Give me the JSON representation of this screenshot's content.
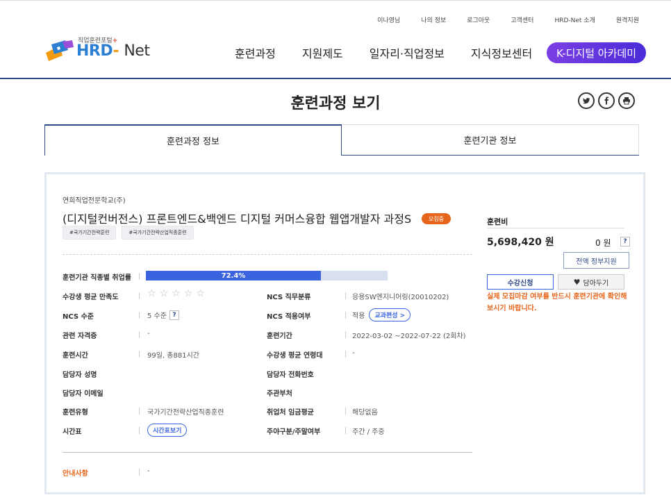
{
  "util_nav": [
    "이나영님",
    "나의 정보",
    "로그아웃",
    "고객센터",
    "HRD-Net 소개",
    "원격지원"
  ],
  "logo": {
    "sub": "직업훈련포털",
    "plus": "+",
    "brand_a": "HRD",
    "dash": "-",
    "brand_b": "Net"
  },
  "gnb": [
    "훈련과정",
    "지원제도",
    "일자리·직업정보",
    "지식정보센터"
  ],
  "gnb_highlight": "K-디지털 아카데미",
  "page_title": "훈련과정 보기",
  "share_icons": [
    "twitter-icon",
    "facebook-icon",
    "print-icon"
  ],
  "tabs": [
    "훈련과정 정보",
    "훈련기관 정보"
  ],
  "course": {
    "org": "연희직업전문학교(주)",
    "title": "(디지털컨버전스) 프론트엔드&백엔드 디지털 커머스융합 웹앱개발자 과정S",
    "badge": "모집중",
    "tags": [
      "#국가기간전략훈련",
      "#국가기간전략산업직종훈련"
    ]
  },
  "details": {
    "employment_label": "훈련기관 직종별 취업률",
    "employment_rate": 72.4,
    "employment_text": "72.4%",
    "satisfaction_label": "수강생 평균 만족도",
    "stars_filled": 0,
    "stars_total": 5,
    "ncs_job_label": "NCS 직무분류",
    "ncs_job_value": "응용SW엔지니어링(20010202)",
    "ncs_level_label": "NCS 수준",
    "ncs_level_value": "5 수준",
    "ncs_apply_label": "NCS 적용여부",
    "ncs_apply_value": "적용",
    "curriculum_btn": "교과편성 >",
    "cert_label": "관련 자격증",
    "cert_value": "-",
    "period_label": "훈련기간",
    "period_value": "2022-03-02 ~2022-07-22 (2회차)",
    "time_label": "훈련시간",
    "time_value": "99일, 총881시간",
    "age_label": "수강생 평균 연령대",
    "age_value": "-",
    "manager_label": "담당자 성명",
    "manager_value": "",
    "phone_label": "담당자 전화번호",
    "phone_value": "",
    "email_label": "담당자 이메일",
    "email_value": "",
    "org_dept_label": "주관부처",
    "org_dept_value": "",
    "type_label": "훈련유형",
    "type_value": "국가기간전략산업직종훈련",
    "wage_label": "취업처 임금평균",
    "wage_value": "해당없음",
    "schedule_label": "시간표",
    "schedule_btn": "시간표보기",
    "daynight_label": "주야구분/주말여부",
    "daynight_value": "주간 / 주중",
    "info_label": "안내사항",
    "info_value": "-"
  },
  "fee": {
    "title": "훈련비",
    "amount": "5,698,420 원",
    "self_pay": "0 원",
    "gov_btn": "전액 정부지원",
    "apply_btn": "수강신청",
    "save_btn": "담아두기",
    "notice": "실제 모집마감 여부를 반드시 훈련기관에 확인해보시기 바랍니다."
  },
  "colors": {
    "primary": "#2e4a86",
    "accent": "#3a63e0",
    "orange": "#e8661c",
    "purple": "#7b3fe4"
  }
}
